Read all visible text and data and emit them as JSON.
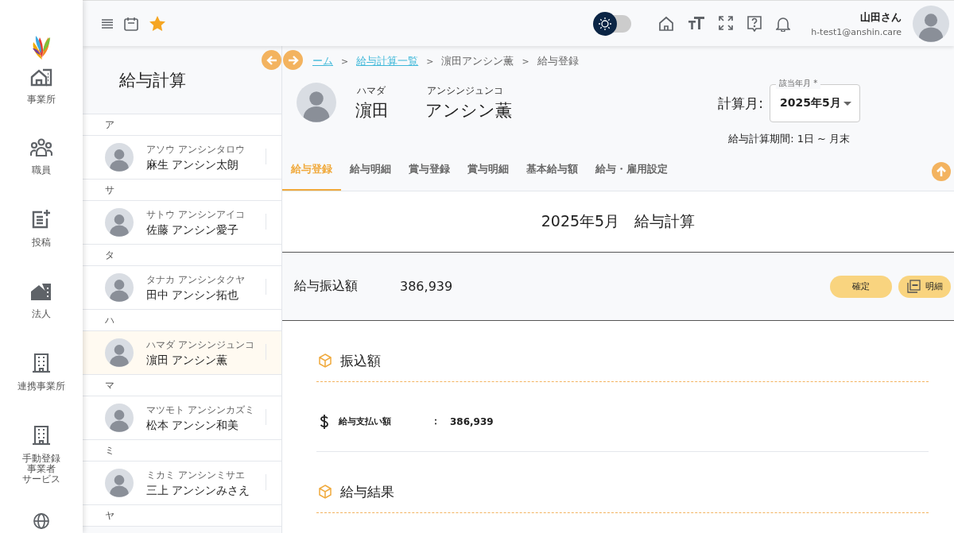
{
  "nav": {
    "items": [
      {
        "kind": "logo"
      },
      {
        "kind": "office",
        "label": "事業所"
      },
      {
        "kind": "people",
        "label": "職員"
      },
      {
        "kind": "post",
        "label": "投稿"
      },
      {
        "kind": "corp",
        "label": "法人"
      },
      {
        "kind": "building",
        "label": "連携事業所"
      },
      {
        "kind": "building",
        "lines": [
          "手動登録",
          "事業者",
          "サービス"
        ]
      },
      {
        "kind": "globe"
      }
    ]
  },
  "topbar": {
    "theme_toggle": {
      "on": false
    },
    "user": {
      "name": "山田さん",
      "email": "h-test1@anshin.care"
    }
  },
  "staff_list": {
    "title": "給与計算",
    "groups": [
      {
        "letter": "ア",
        "people": [
          {
            "kana": "アソウ アンシンタロウ",
            "name": "麻生 アンシン太朗",
            "selected": false
          }
        ]
      },
      {
        "letter": "サ",
        "people": [
          {
            "kana": "サトウ アンシンアイコ",
            "name": "佐藤 アンシン愛子",
            "selected": false
          }
        ]
      },
      {
        "letter": "タ",
        "people": [
          {
            "kana": "タナカ アンシンタクヤ",
            "name": "田中 アンシン拓也",
            "selected": false
          }
        ]
      },
      {
        "letter": "ハ",
        "people": [
          {
            "kana": "ハマダ アンシンジュンコ",
            "name": "濵田 アンシン薫",
            "selected": true
          }
        ]
      },
      {
        "letter": "マ",
        "people": [
          {
            "kana": "マツモト アンシンカズミ",
            "name": "松本 アンシン和美",
            "selected": false
          }
        ]
      },
      {
        "letter": "ミ",
        "people": [
          {
            "kana": "ミカミ アンシンミサエ",
            "name": "三上 アンシンみさえ",
            "selected": false
          }
        ]
      },
      {
        "letter": "ヤ"
      }
    ]
  },
  "main": {
    "breadcrumb": {
      "separator": ">",
      "items": [
        {
          "label": "ーム",
          "link": true
        },
        {
          "label": "給与計算一覧",
          "link": true
        },
        {
          "label": "濵田アンシン薫",
          "link": false
        },
        {
          "label": "給与登録",
          "link": false
        }
      ]
    },
    "employee": {
      "family_kana": "ハマダ",
      "family": "濵田",
      "given_kana": "アンシンジュンコ",
      "given": "アンシン薫"
    },
    "month": {
      "prefix": "計算月:",
      "label": "該当年月 *",
      "value": "2025年5月"
    },
    "period": "給与計算期間: 1日 ~ 月末",
    "tabs": [
      {
        "label": "給与登録",
        "selected": true
      },
      {
        "label": "給与明細",
        "selected": false
      },
      {
        "label": "賞与登録",
        "selected": false
      },
      {
        "label": "賞与明細",
        "selected": false
      },
      {
        "label": "基本給与額",
        "selected": false
      },
      {
        "label": "給与・雇用設定",
        "selected": false
      }
    ],
    "heading": "2025年5月　給与計算",
    "summary": {
      "label": "給与振込額",
      "amount": "386,939",
      "buttons": [
        {
          "label": "確定",
          "kind": "plain"
        },
        {
          "label": "明細",
          "kind": "pdf"
        }
      ]
    },
    "sections": [
      {
        "title": "振込額",
        "rows": [
          {
            "label": "給与支払い額",
            "separator": "：",
            "value": "386,939"
          }
        ]
      },
      {
        "title": "給与結果"
      }
    ]
  }
}
